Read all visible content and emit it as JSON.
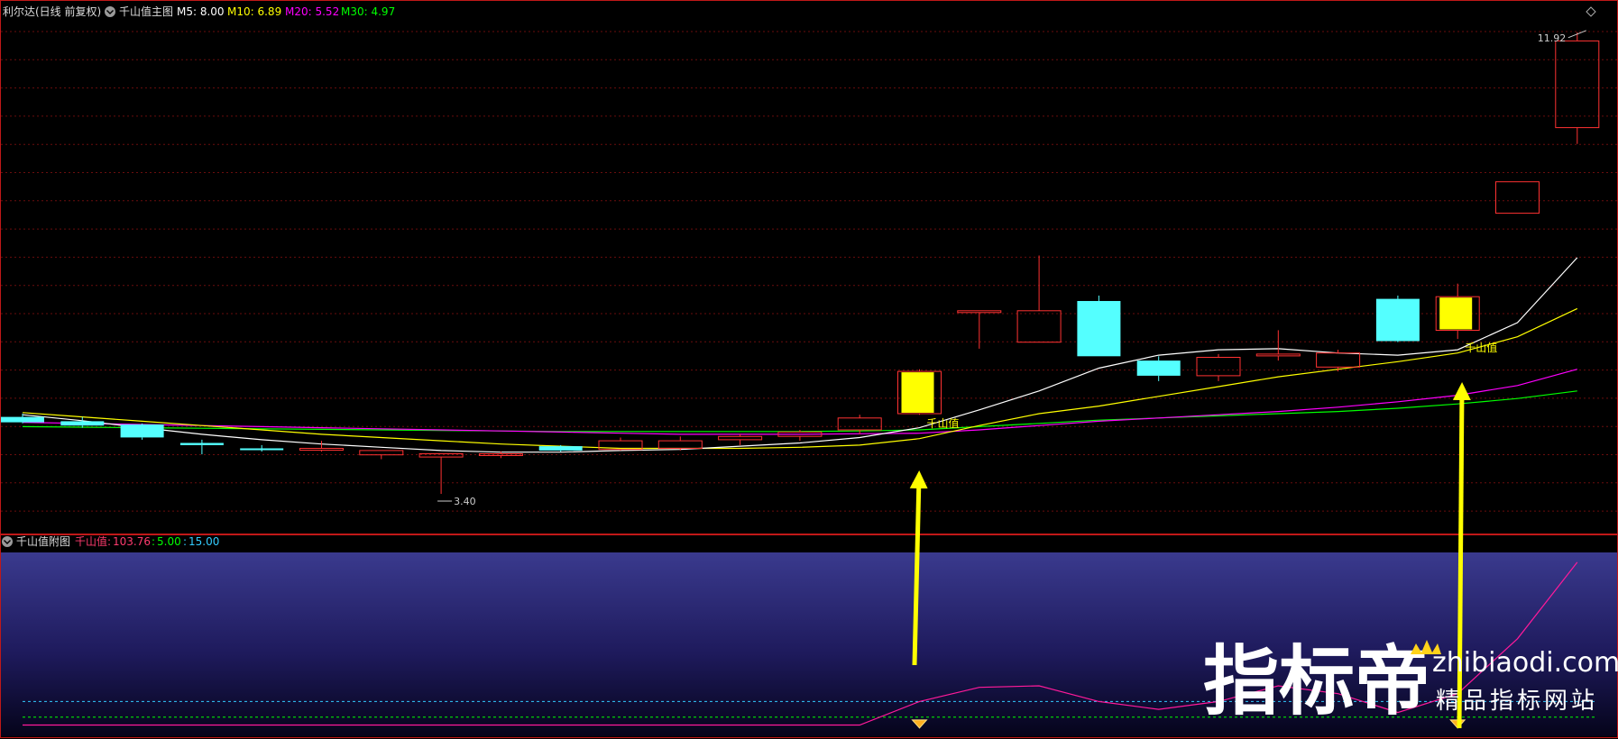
{
  "main_panel": {
    "stock_label": "利尔达(日线 前复权)",
    "indicator_name": "千山值主图",
    "ma_legend": [
      {
        "label": "M5: 8.00",
        "color": "#ffffff"
      },
      {
        "label": "M10: 6.89",
        "color": "#ffff00"
      },
      {
        "label": "M20: 5.52",
        "color": "#ff00ff"
      },
      {
        "label": "M30: 4.97",
        "color": "#00ff00"
      }
    ],
    "high_label": "11.92",
    "low_label": "3.40",
    "signal_label": "千山值"
  },
  "sub_panel": {
    "indicator_name": "千山值附图",
    "value_label": "千山值",
    "value": "103.76",
    "level_a": "5.00",
    "level_b": "15.00"
  },
  "watermark": {
    "brand": "指标帝",
    "url": "zhibiaodi.com",
    "tagline": "精品指标网站"
  },
  "colors": {
    "up": "#ff3232",
    "down": "#54ffff",
    "signal": "#ffff00",
    "m5": "#ffffff",
    "m10": "#ffff00",
    "m20": "#ff00ff",
    "m30": "#00ff00",
    "sub_line": "#ff1a9a",
    "sub_value": "#ff3b6e",
    "level_a": "#00ff00",
    "level_b": "#33ccff",
    "frame": "#c01818"
  },
  "chart_data": [
    {
      "type": "candlestick",
      "title": "利尔达(日线 前复权)",
      "ylim": [
        3.2,
        12.1
      ],
      "candles": [
        {
          "o": 4.82,
          "h": 4.88,
          "l": 4.7,
          "c": 4.72
        },
        {
          "o": 4.74,
          "h": 4.82,
          "l": 4.62,
          "c": 4.66
        },
        {
          "o": 4.68,
          "h": 4.7,
          "l": 4.4,
          "c": 4.44
        },
        {
          "o": 4.34,
          "h": 4.4,
          "l": 4.13,
          "c": 4.3
        },
        {
          "o": 4.24,
          "h": 4.3,
          "l": 4.18,
          "c": 4.22
        },
        {
          "o": 4.24,
          "h": 4.38,
          "l": 4.18,
          "c": 4.24
        },
        {
          "o": 4.12,
          "h": 4.2,
          "l": 4.04,
          "c": 4.2
        },
        {
          "o": 4.08,
          "h": 4.14,
          "l": 3.4,
          "c": 4.14
        },
        {
          "o": 4.12,
          "h": 4.18,
          "l": 4.06,
          "c": 4.14
        },
        {
          "o": 4.28,
          "h": 4.3,
          "l": 4.18,
          "c": 4.2
        },
        {
          "o": 4.22,
          "h": 4.44,
          "l": 4.2,
          "c": 4.38
        },
        {
          "o": 4.24,
          "h": 4.46,
          "l": 4.2,
          "c": 4.38
        },
        {
          "o": 4.4,
          "h": 4.5,
          "l": 4.3,
          "c": 4.46
        },
        {
          "o": 4.46,
          "h": 4.58,
          "l": 4.38,
          "c": 4.54
        },
        {
          "o": 4.58,
          "h": 4.86,
          "l": 4.5,
          "c": 4.8
        },
        {
          "o": 4.88,
          "h": 5.7,
          "l": 4.86,
          "c": 5.66,
          "signal": true
        },
        {
          "o": 6.78,
          "h": 6.78,
          "l": 6.08,
          "c": 6.78
        },
        {
          "o": 6.2,
          "h": 7.8,
          "l": 6.2,
          "c": 6.78
        },
        {
          "o": 6.96,
          "h": 7.06,
          "l": 5.94,
          "c": 5.94
        },
        {
          "o": 5.86,
          "h": 5.94,
          "l": 5.48,
          "c": 5.58
        },
        {
          "o": 5.58,
          "h": 5.98,
          "l": 5.48,
          "c": 5.92
        },
        {
          "o": 5.96,
          "h": 6.42,
          "l": 5.86,
          "c": 5.98
        },
        {
          "o": 5.74,
          "h": 6.06,
          "l": 5.66,
          "c": 6.0
        },
        {
          "o": 7.0,
          "h": 7.06,
          "l": 6.2,
          "c": 6.22
        },
        {
          "o": 6.42,
          "h": 7.28,
          "l": 6.26,
          "c": 7.04,
          "signal": true
        },
        {
          "o": 8.58,
          "h": 9.16,
          "l": 8.58,
          "c": 9.16
        },
        {
          "o": 10.16,
          "h": 11.92,
          "l": 9.86,
          "c": 11.76
        }
      ],
      "series": [
        {
          "name": "M5",
          "values": [
            4.86,
            4.75,
            4.62,
            4.5,
            4.4,
            4.32,
            4.26,
            4.2,
            4.17,
            4.17,
            4.2,
            4.22,
            4.28,
            4.34,
            4.44,
            4.62,
            4.95,
            5.3,
            5.72,
            5.96,
            6.06,
            6.08,
            6.0,
            5.96,
            6.06,
            6.56,
            7.76
          ]
        },
        {
          "name": "M10",
          "values": [
            4.9,
            4.82,
            4.74,
            4.66,
            4.58,
            4.5,
            4.44,
            4.38,
            4.32,
            4.28,
            4.24,
            4.24,
            4.24,
            4.26,
            4.3,
            4.42,
            4.66,
            4.88,
            5.02,
            5.2,
            5.38,
            5.56,
            5.7,
            5.84,
            6.0,
            6.3,
            6.82
          ]
        },
        {
          "name": "M20",
          "values": [
            4.72,
            4.7,
            4.68,
            4.66,
            4.64,
            4.62,
            4.6,
            4.58,
            4.56,
            4.54,
            4.52,
            4.5,
            4.5,
            4.5,
            4.51,
            4.52,
            4.58,
            4.66,
            4.74,
            4.8,
            4.86,
            4.92,
            5.0,
            5.1,
            5.22,
            5.4,
            5.7
          ]
        },
        {
          "name": "M30",
          "values": [
            4.64,
            4.63,
            4.62,
            4.61,
            4.6,
            4.59,
            4.58,
            4.57,
            4.56,
            4.55,
            4.55,
            4.55,
            4.55,
            4.55,
            4.56,
            4.58,
            4.64,
            4.7,
            4.76,
            4.8,
            4.84,
            4.88,
            4.92,
            4.98,
            5.06,
            5.16,
            5.3
          ]
        }
      ]
    },
    {
      "type": "line",
      "title": "千山值附图",
      "ylim": [
        -2,
        110
      ],
      "levels": [
        5,
        15
      ],
      "series": [
        {
          "name": "千山值",
          "values": [
            0,
            0,
            0,
            0,
            0,
            0,
            0,
            0,
            0,
            0,
            0,
            0,
            0,
            0,
            0,
            15,
            24,
            25,
            15,
            10,
            15,
            25,
            20,
            8,
            20,
            55,
            103.76
          ]
        }
      ],
      "signal_markers": [
        15,
        24
      ]
    }
  ]
}
